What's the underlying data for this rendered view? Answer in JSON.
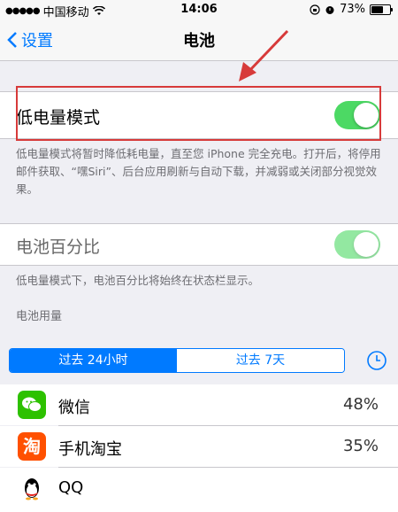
{
  "status": {
    "carrier": "中国移动",
    "time": "14:06",
    "battery": "73%",
    "battery_level": 0.73
  },
  "nav": {
    "back_label": "设置",
    "title": "电池"
  },
  "low_power": {
    "label": "低电量模式",
    "on": true,
    "description": "低电量模式将暂时降低耗电量，直至您 iPhone 完全充电。打开后，将停用邮件获取、“嘿Siri”、后台应用刷新与自动下载，并减弱或关闭部分视觉效果。"
  },
  "battery_percentage": {
    "label": "电池百分比",
    "on": true,
    "description": "低电量模式下，电池百分比将始终在状态栏显示。"
  },
  "usage": {
    "header": "电池用量",
    "tabs": [
      "过去 24小时",
      "过去 7天"
    ],
    "apps": [
      {
        "name": "微信",
        "percent": "48%",
        "icon": "wechat-icon"
      },
      {
        "name": "手机淘宝",
        "percent": "35%",
        "icon": "taobao-icon",
        "icon_text": "淘"
      },
      {
        "name": "QQ",
        "percent": "",
        "icon": "qq-icon"
      }
    ]
  },
  "colors": {
    "accent": "#007aff",
    "toggle_on": "#4cd964",
    "annotation": "#d73a3a"
  }
}
